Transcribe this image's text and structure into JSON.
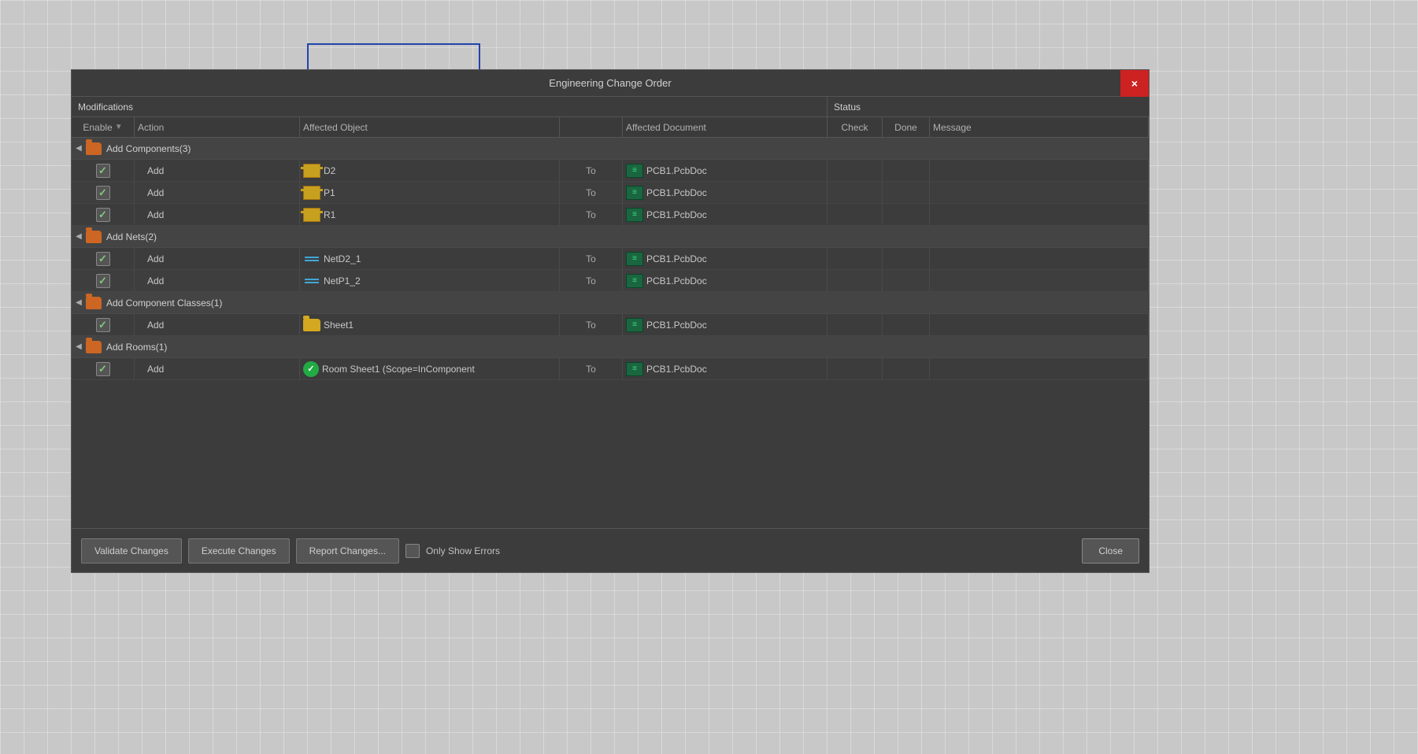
{
  "dialog": {
    "title": "Engineering Change Order",
    "close_btn_label": "×"
  },
  "table": {
    "header_modifications": "Modifications",
    "header_status": "Status",
    "col_enable": "Enable",
    "col_action": "Action",
    "col_affected_object": "Affected Object",
    "col_affected_document": "Affected Document",
    "col_check": "Check",
    "col_done": "Done",
    "col_message": "Message"
  },
  "groups": [
    {
      "label": "Add Components(3)",
      "items": [
        {
          "checked": true,
          "action": "Add",
          "obj_text": "D2",
          "obj_type": "comp",
          "to": "To",
          "doc_text": "PCB1.PcbDoc"
        },
        {
          "checked": true,
          "action": "Add",
          "obj_text": "P1",
          "obj_type": "comp",
          "to": "To",
          "doc_text": "PCB1.PcbDoc"
        },
        {
          "checked": true,
          "action": "Add",
          "obj_text": "R1",
          "obj_type": "comp",
          "to": "To",
          "doc_text": "PCB1.PcbDoc"
        }
      ]
    },
    {
      "label": "Add Nets(2)",
      "items": [
        {
          "checked": true,
          "action": "Add",
          "obj_text": "NetD2_1",
          "obj_type": "net",
          "to": "To",
          "doc_text": "PCB1.PcbDoc"
        },
        {
          "checked": true,
          "action": "Add",
          "obj_text": "NetP1_2",
          "obj_type": "net",
          "to": "To",
          "doc_text": "PCB1.PcbDoc"
        }
      ]
    },
    {
      "label": "Add Component Classes(1)",
      "items": [
        {
          "checked": true,
          "action": "Add",
          "obj_text": "Sheet1",
          "obj_type": "folder",
          "to": "To",
          "doc_text": "PCB1.PcbDoc"
        }
      ]
    },
    {
      "label": "Add Rooms(1)",
      "items": [
        {
          "checked": true,
          "action": "Add",
          "obj_text": "Room Sheet1 (Scope=InComponent",
          "obj_type": "room",
          "to": "To",
          "doc_text": "PCB1.PcbDoc"
        }
      ]
    }
  ],
  "buttons": {
    "validate": "Validate Changes",
    "execute": "Execute Changes",
    "report": "Report Changes...",
    "only_errors": "Only Show Errors",
    "close": "Close"
  }
}
